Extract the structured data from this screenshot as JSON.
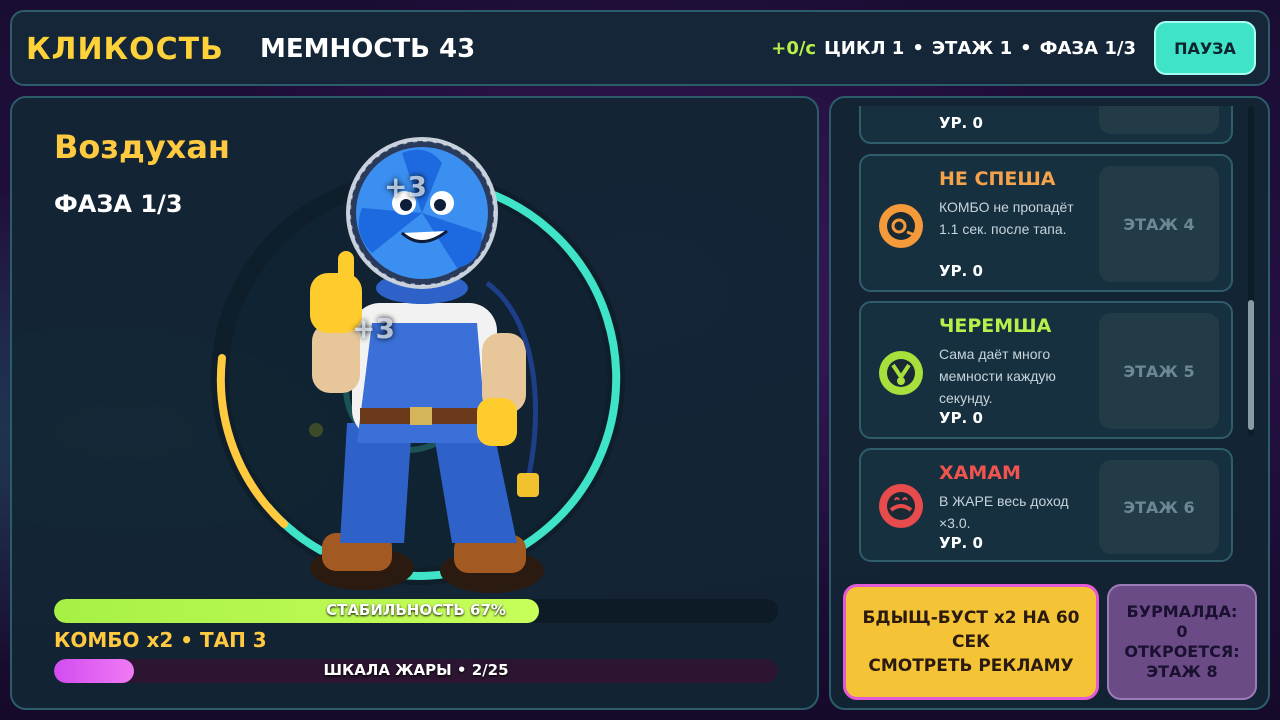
{
  "topbar": {
    "logo": "КЛИКОСТЬ",
    "memnost": "МЕМНОСТЬ  43",
    "rate": "+0/с",
    "cycle": "ЦИКЛ 1",
    "floor": "ЭТАЖ 1",
    "phase": "ФАЗА 1/3",
    "pause_label": "ПАУЗА"
  },
  "character": {
    "name": "Воздухан",
    "phase": "ФАЗА 1/3",
    "popups": [
      "+3",
      "+3"
    ]
  },
  "stability": {
    "label": "СТАБИЛЬНОСТЬ  67%",
    "value": 0.67
  },
  "combo": "КОМБО x2  •  ТАП 3",
  "heat": {
    "label": "ШКАЛА ЖАРЫ • 2/25",
    "value": 0.08
  },
  "upgrades": [
    {
      "title": "",
      "desc": "",
      "level": "УР. 0",
      "floor_label": "",
      "title_color": "#f5a34b",
      "icon": "partial-icon"
    },
    {
      "title": "НЕ СПЕША",
      "desc": "КОМБО не пропадёт 1.1 сек. после тапа.",
      "level": "УР. 0",
      "floor_label": "ЭТАЖ 4",
      "title_color": "#f5a34b",
      "icon": "snail-clock-icon"
    },
    {
      "title": "ЧЕРЕМША",
      "desc": "Сама даёт много мемности каждую секунду.",
      "level": "УР. 0",
      "floor_label": "ЭТАЖ 5",
      "title_color": "#b7f04a",
      "icon": "garlic-icon"
    },
    {
      "title": "ХАМАМ",
      "desc": "В ЖАРЕ весь доход ×3.0.",
      "level": "УР. 0",
      "floor_label": "ЭТАЖ 6",
      "title_color": "#f0544f",
      "icon": "steam-bath-icon"
    }
  ],
  "boost": {
    "line1": "БДЫЩ-БУСТ x2 НА 60 СЕК",
    "line2": "СМОТРЕТЬ РЕКЛАМУ"
  },
  "burmalda": {
    "line1": "БУРМАЛДА:",
    "line2": "0",
    "line3": "ОТКРОЕТСЯ:",
    "line4": "ЭТАЖ 8"
  },
  "colors": {
    "accent": "#3fe3c7",
    "gold": "#ffc940",
    "lime": "#b7f04a",
    "pink": "#e25ad6"
  }
}
